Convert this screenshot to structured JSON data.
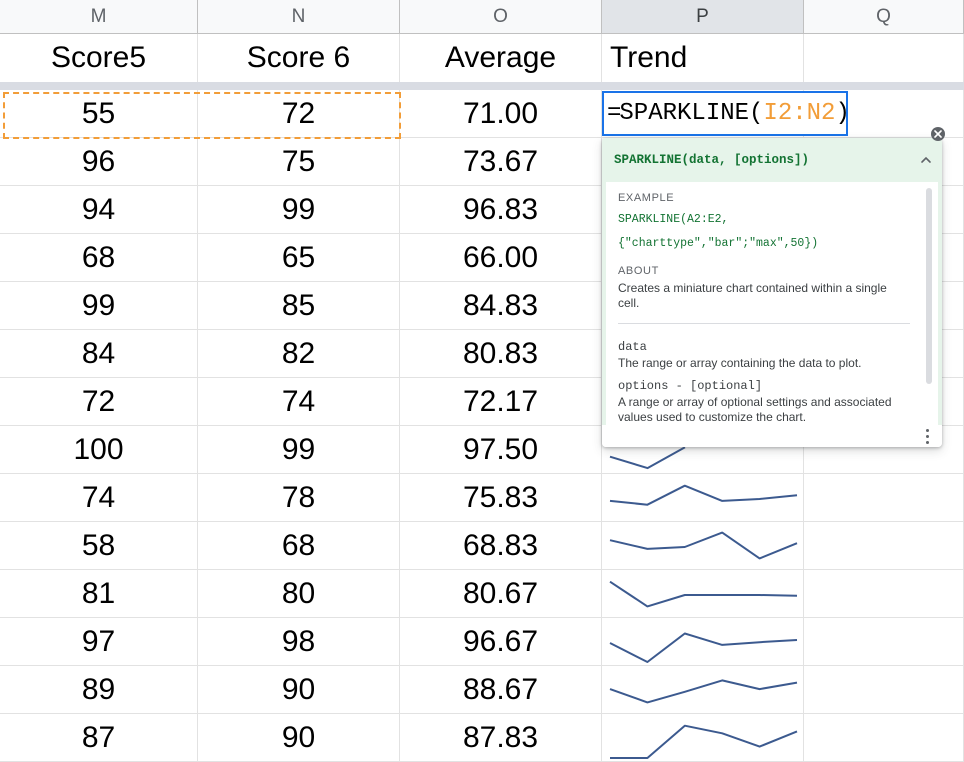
{
  "columns": [
    {
      "letter": "M",
      "header": "Score5"
    },
    {
      "letter": "N",
      "header": "Score 6"
    },
    {
      "letter": "O",
      "header": "Average"
    },
    {
      "letter": "P",
      "header": "Trend"
    },
    {
      "letter": "Q",
      "header": ""
    }
  ],
  "rows": [
    {
      "m": "55",
      "n": "72",
      "o": "71.00",
      "trend": null
    },
    {
      "m": "96",
      "n": "75",
      "o": "73.67",
      "trend": null
    },
    {
      "m": "94",
      "n": "99",
      "o": "96.83",
      "trend": null
    },
    {
      "m": "68",
      "n": "65",
      "o": "66.00",
      "trend": null
    },
    {
      "m": "99",
      "n": "85",
      "o": "84.83",
      "trend": null
    },
    {
      "m": "84",
      "n": "82",
      "o": "80.83",
      "trend": null
    },
    {
      "m": "72",
      "n": "74",
      "o": "72.17",
      "trend": null
    },
    {
      "m": "100",
      "n": "99",
      "o": "97.50",
      "trend": [
        0.35,
        0.05,
        0.6
      ]
    },
    {
      "m": "74",
      "n": "78",
      "o": "75.83",
      "trend": [
        0.45,
        0.35,
        0.85,
        0.45,
        0.5,
        0.6
      ]
    },
    {
      "m": "58",
      "n": "68",
      "o": "68.83",
      "trend": [
        0.68,
        0.45,
        0.5,
        0.88,
        0.2,
        0.6
      ]
    },
    {
      "m": "81",
      "n": "80",
      "o": "80.67",
      "trend": [
        0.85,
        0.2,
        0.5,
        0.5,
        0.5,
        0.48
      ]
    },
    {
      "m": "97",
      "n": "98",
      "o": "96.67",
      "trend": [
        0.5,
        0.0,
        0.75,
        0.45,
        0.52,
        0.58
      ]
    },
    {
      "m": "89",
      "n": "90",
      "o": "88.67",
      "trend": [
        0.55,
        0.2,
        0.48,
        0.78,
        0.55,
        0.72
      ]
    },
    {
      "m": "87",
      "n": "90",
      "o": "87.83",
      "trend": [
        0.0,
        0.0,
        0.85,
        0.65,
        0.3,
        0.7
      ]
    }
  ],
  "formula": {
    "prefix": "=",
    "function_name": "SPARKLINE(",
    "range_ref": "I2:N2",
    "suffix": ")"
  },
  "help": {
    "signature": "SPARKLINE(data, [options])",
    "example_label": "EXAMPLE",
    "example_line1": "SPARKLINE(A2:E2,",
    "example_line2": "{\"charttype\",\"bar\";\"max\",50})",
    "about_label": "ABOUT",
    "about_text": "Creates a miniature chart contained within a single cell.",
    "arg1_name": "data",
    "arg1_desc": "The range or array containing the data to plot.",
    "arg2_name": "options - [optional]",
    "arg2_desc": "A range or array of optional settings and associated values used to customize the chart."
  },
  "colors": {
    "selection_border": "#1a73e8",
    "copy_range_border": "#f29d38",
    "range_reference": "#f29d38",
    "sparkline": "#3c5a8f",
    "help_header_bg": "#e6f4ea",
    "help_code": "#137333"
  },
  "icons": {
    "close": "close-icon",
    "collapse": "chevron-up-icon",
    "more": "more-vert-icon"
  }
}
